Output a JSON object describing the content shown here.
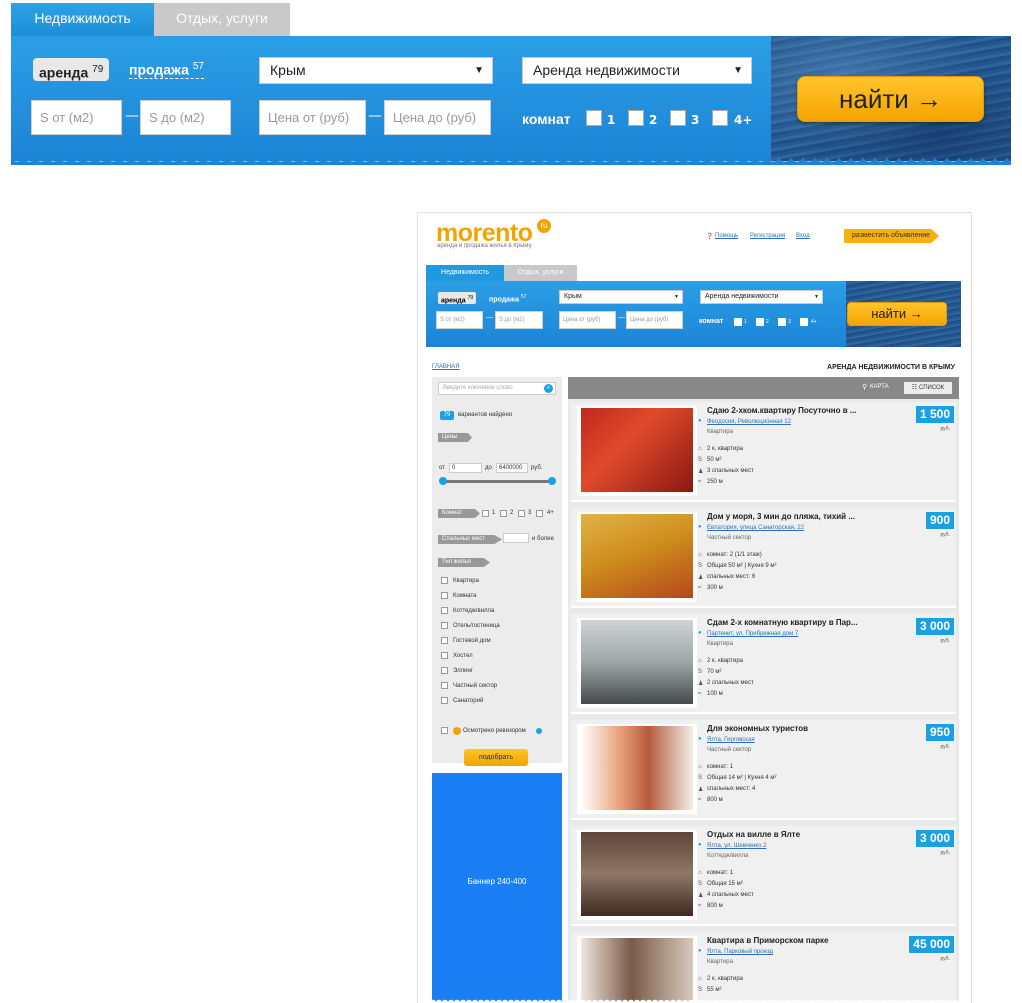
{
  "widget": {
    "tab_realty": "Недвижимость",
    "tab_rest": "Отдых, услуги",
    "rent_label": "аренда",
    "rent_count": "79",
    "sale_label": "продажа",
    "sale_count": "57",
    "region": "Крым",
    "deal_type": "Аренда недвижимости",
    "area_from": "S от (м2)",
    "area_to": "S до (м2)",
    "price_from": "Цена от (руб)",
    "price_to": "Цена до (руб)",
    "dash": "—",
    "rooms_label": "комнат",
    "rooms": [
      "1",
      "2",
      "3",
      "4+"
    ],
    "find_button": "найти →"
  },
  "preview": {
    "logo": "morento",
    "logo_badge": "ru",
    "tagline": "аренда и продажа жилья в Крыму",
    "help": "Помощь",
    "register": "Регистрация",
    "login": "Вход",
    "post_ad": "разместить объявление",
    "breadcrumb": "ГЛАВНАЯ",
    "page_title": "АРЕНДА НЕДВИЖИМОСТИ В КРЫМУ",
    "sidebar": {
      "search_placeholder": "Введите ключевое слово",
      "found_count": "79",
      "found_label": "вариантов найдено",
      "prices_header": "Цены",
      "from": "от",
      "price_min": "0",
      "to": "до",
      "price_max": "6400000",
      "currency": "руб.",
      "rooms_header": "Комнат",
      "room_options": [
        "1",
        "2",
        "3",
        "4+"
      ],
      "beds_header": "Спальных мест",
      "or_more": "и более",
      "type_header": "Тип жилья",
      "types": [
        "Квартира",
        "Комната",
        "Коттедж/вилла",
        "Отель/гостиница",
        "Гостевой дом",
        "Хостел",
        "Эллинг",
        "Частный сектор",
        "Санаторий"
      ],
      "inspected": "Осмотрено ревизором",
      "pick_button": "подобрать",
      "banner": "Баннер 240-400"
    },
    "map_label": "КАРТА",
    "list_label": "СПИСОК",
    "listings": [
      {
        "title": "Сдаю 2-хком.квартиру Посуточно в ...",
        "address": "Феодосия, Революционная 12",
        "type": "Квартира",
        "lines": [
          "2 к. квартира",
          "50 м²",
          "3 спальных мест",
          "250 м"
        ],
        "price": "1 500",
        "currency": "руб."
      },
      {
        "title": "Дом у моря, 3 мин до пляжа, тихий ...",
        "address": "Евпатория, улица Санаторская, 22",
        "type": "Частный сектор",
        "lines": [
          "комнат: 2 (1/1 этаж)",
          "Общая 50 м² | Кухня 9 м²",
          "спальных мест: 6",
          "300 м"
        ],
        "price": "900",
        "currency": "руб."
      },
      {
        "title": "Сдам 2-х комнатную квартиру в Пар...",
        "address": "Партенит, ул. Прибрежная дом 7",
        "type": "Квартира",
        "lines": [
          "2 к. квартира",
          "70 м²",
          "2 спальных мест",
          "100 м"
        ],
        "price": "3 000",
        "currency": "руб."
      },
      {
        "title": "Для экономных туристов",
        "address": "Ялта, Гирговская",
        "type": "Частный сектор",
        "lines": [
          "комнат: 1",
          "Общая 14 м² | Кухня 4 м²",
          "спальных мест: 4",
          "800 м"
        ],
        "price": "950",
        "currency": "руб."
      },
      {
        "title": "Отдых на вилле в Ялте",
        "address": "Ялта, ул. Шевченко 2",
        "type": "Коттедж/вилла",
        "lines": [
          "комнат: 1",
          "Общая 15 м²",
          "4 спальных мест",
          "800 м"
        ],
        "price": "3 000",
        "currency": "руб."
      },
      {
        "title": "Квартира в Приморском парке",
        "address": "Ялта, Парковый проезд",
        "type": "Квартира",
        "lines": [
          "2 к. квартира",
          "55 м²"
        ],
        "price": "45 000",
        "currency": "руб."
      }
    ]
  }
}
